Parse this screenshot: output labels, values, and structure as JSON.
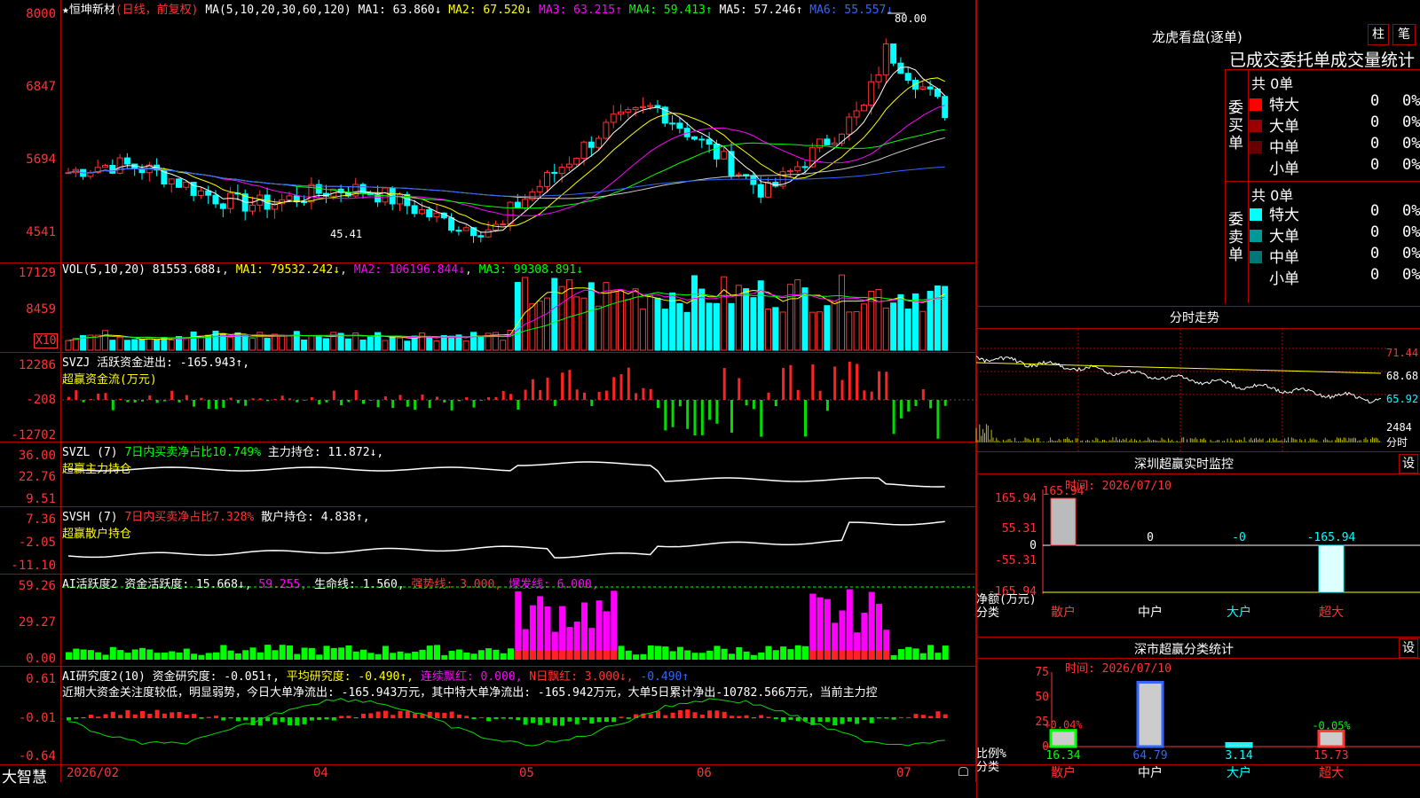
{
  "stock": {
    "star": "★",
    "name": "恒坤新材",
    "period": "(日线，前复权)"
  },
  "ma_header": {
    "label": "MA(5,10,20,30,60,120)",
    "items": [
      {
        "label": "MA1:",
        "value": "63.860↓",
        "color": "#ffffff"
      },
      {
        "label": "MA2:",
        "value": "67.520↓",
        "color": "#ffff00"
      },
      {
        "label": "MA3:",
        "value": "63.215↑",
        "color": "#ff00ff"
      },
      {
        "label": "MA4:",
        "value": "59.413↑",
        "color": "#00ff00"
      },
      {
        "label": "MA5:",
        "value": "57.246↑",
        "color": "#ffffff"
      },
      {
        "label": "MA6:",
        "value": "55.557↓",
        "color": "#3366ff"
      }
    ]
  },
  "price_axis": [
    "8000",
    "6847",
    "5694",
    "4541"
  ],
  "price_annotations": {
    "high": "80.00",
    "low": "45.41"
  },
  "vol": {
    "header": "VOL(5,10,20)",
    "value": "81553.688↓",
    "ma1": "MA1: 79532.242↓",
    "ma2": "MA2: 106196.844↓",
    "ma3": "MA3: 99308.891↓",
    "axis": [
      "17129",
      "8459"
    ],
    "unit": "X10"
  },
  "svzj": {
    "header": "SVZJ  活跃资金进出: -165.943↑,",
    "sub": "超赢资金流(万元)",
    "axis": [
      "12286",
      "-208",
      "-12702"
    ]
  },
  "svzl": {
    "header": "SVZL (7)",
    "pct": "7日内买卖净占比10.749%",
    "hold": "主力持仓: 11.872↓,",
    "sub": "超赢主力持仓",
    "axis": [
      "36.00",
      "22.76",
      "9.51"
    ]
  },
  "svsh": {
    "header": "SVSH (7)",
    "pct": "7日内买卖净占比7.328%",
    "hold": "散户持仓: 4.838↑,",
    "sub": "超赢散户持仓",
    "axis": [
      "7.36",
      "-2.05",
      "-11.10"
    ]
  },
  "ai1": {
    "header": "AI活跃度2",
    "a": "资金活跃度: 15.668↓,",
    "b": "59.255,",
    "c": "生命线: 1.560,",
    "d": "强势线: 3.000,",
    "e": "爆发线: 6.000,",
    "axis": [
      "59.26",
      "29.27",
      "0.00"
    ]
  },
  "ai2": {
    "header": "AI研究度2(10)",
    "a": "资金研究度: -0.051↑,",
    "b": "平均研究度: -0.490↑,",
    "c": "连续飘红: 0.000,",
    "d": "N日飘红: 3.000↓,",
    "e": "-0.490↑",
    "text": "近期大资金关注度较低，明显弱势，今日大单净流出: -165.943万元，其中特大单净流出: -165.942万元，大单5日累计净出-10782.566万元，当前主力控",
    "axis": [
      "0.61",
      "-0.01",
      "-0.64"
    ]
  },
  "date_axis": [
    "2026/02",
    "04",
    "05",
    "06",
    "07"
  ],
  "brand": "大智慧",
  "longhu": {
    "title": "龙虎看盘(逐单)",
    "btn1": "柱",
    "btn2": "笔",
    "subtitle": "已成交委托单成交量统计",
    "buy": {
      "label": "委买单",
      "count": "共 0单",
      "rows": [
        {
          "name": "特大",
          "color": "#ff0000",
          "v": "0",
          "p": "0%"
        },
        {
          "name": "大单",
          "color": "#990000",
          "v": "0",
          "p": "0%"
        },
        {
          "name": "中单",
          "color": "#660000",
          "v": "0",
          "p": "0%"
        },
        {
          "name": "小单",
          "color": "#000000",
          "v": "0",
          "p": "0%"
        }
      ]
    },
    "sell": {
      "label": "委卖单",
      "count": "共 0单",
      "rows": [
        {
          "name": "特大",
          "color": "#00ffff",
          "v": "0",
          "p": "0%"
        },
        {
          "name": "大单",
          "color": "#009999",
          "v": "0",
          "p": "0%"
        },
        {
          "name": "中单",
          "color": "#007777",
          "v": "0",
          "p": "0%"
        },
        {
          "name": "小单",
          "color": "#000000",
          "v": "0",
          "p": "0%"
        }
      ]
    }
  },
  "intraday": {
    "title": "分时走势",
    "axis": [
      "71.44",
      "68.68",
      "65.92"
    ],
    "vol": "2484",
    "vol_unit": "分时"
  },
  "monitor": {
    "title": "深圳超赢实时监控",
    "btn": "设",
    "time": "时间: 2026/07/10",
    "axis": [
      "165.94",
      "55.31",
      "0",
      "-55.31",
      "-165.94"
    ],
    "ylabel1": "净额(万元)",
    "ylabel2": "分类",
    "bars": [
      {
        "cat": "散户",
        "val": "165.94"
      },
      {
        "cat": "中户",
        "val": "0"
      },
      {
        "cat": "大户",
        "val": "-0"
      },
      {
        "cat": "超大",
        "val": "-165.94"
      }
    ]
  },
  "classstat": {
    "title": "深市超赢分类统计",
    "btn": "设",
    "time": "时间: 2026/07/10",
    "axis": [
      "75",
      "50",
      "25",
      "0"
    ],
    "ylabel1": "比例%",
    "ylabel2": "分类",
    "bars": [
      {
        "cat": "散户",
        "val": "16.34",
        "top": "+0.04%"
      },
      {
        "cat": "中户",
        "val": "64.79",
        "top": ""
      },
      {
        "cat": "大户",
        "val": "3.14",
        "top": ""
      },
      {
        "cat": "超大",
        "val": "15.73",
        "top": "-0.05%"
      }
    ]
  }
}
